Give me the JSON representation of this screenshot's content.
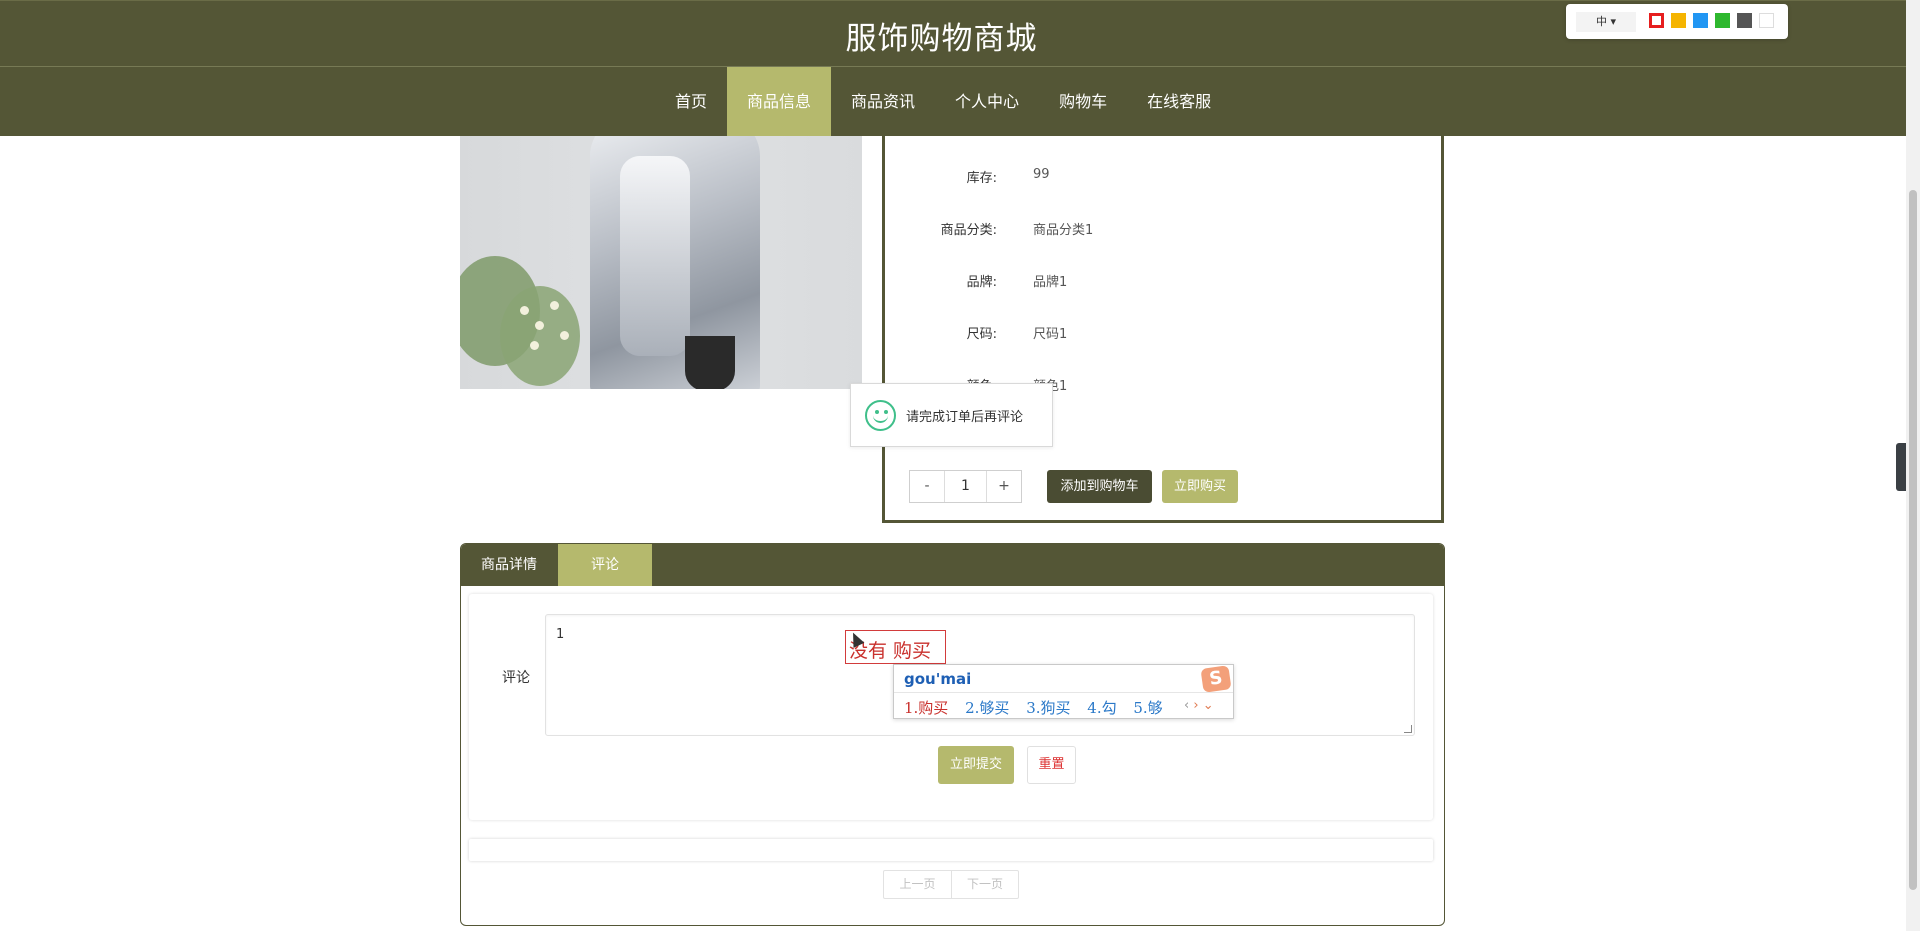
{
  "header": {
    "site_title": "服饰购物商城"
  },
  "nav": {
    "items": [
      {
        "label": "首页"
      },
      {
        "label": "商品信息",
        "active": true
      },
      {
        "label": "商品资讯"
      },
      {
        "label": "个人中心"
      },
      {
        "label": "购物车"
      },
      {
        "label": "在线客服"
      }
    ]
  },
  "theme_switcher": {
    "language_label": "中",
    "swatches": [
      "#e61e1e",
      "#f5b400",
      "#2196f3",
      "#2eb82e",
      "#555555",
      "#ffffff"
    ]
  },
  "product": {
    "fields": [
      {
        "label": "库存:",
        "value": "99"
      },
      {
        "label": "商品分类:",
        "value": "商品分类1"
      },
      {
        "label": "品牌:",
        "value": "品牌1"
      },
      {
        "label": "尺码:",
        "value": "尺码1"
      },
      {
        "label": "颜色:",
        "value": "颜色1"
      }
    ],
    "quantity": {
      "minus": "-",
      "value": "1",
      "plus": "+"
    },
    "add_to_cart_label": "添加到购物车",
    "buy_now_label": "立即购买"
  },
  "toast": {
    "message": "请完成订单后再评论"
  },
  "tabs": [
    {
      "label": "商品详情"
    },
    {
      "label": "评论",
      "active": true
    }
  ],
  "comment_form": {
    "label": "评论",
    "value": "1",
    "submit_label": "立即提交",
    "reset_label": "重置"
  },
  "pager": {
    "prev_label": "上一页",
    "next_label": "下一页"
  },
  "ime": {
    "composition": "没有 购买",
    "pinyin": "gou'mai",
    "candidates": [
      "1.购买",
      "2.够买",
      "3.狗买",
      "4.勾",
      "5.够"
    ]
  },
  "side_tab": {
    "arrow": "‹"
  },
  "colors": {
    "header_bg": "#545636",
    "accent": "#b5b96d",
    "cart_button": "#4a4c33"
  }
}
